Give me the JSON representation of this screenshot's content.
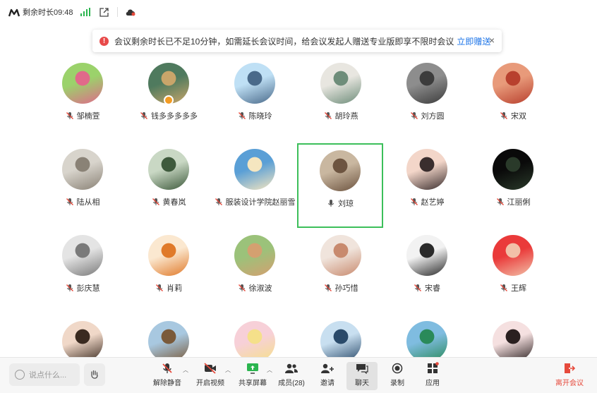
{
  "topbar": {
    "remaining_label": "剩余时长09:48",
    "signal_color": "#2bb54f"
  },
  "notice": {
    "text": "会议剩余时长已不足10分钟，如需延长会议时间，给会议发起人赠送专业版即享不限时会议",
    "link": "立即赠送",
    "close": "×"
  },
  "participants": [
    {
      "name": "邹楠萱",
      "muted": true,
      "c1": "#9bd26b",
      "c2": "#e06a8a"
    },
    {
      "name": "钱多多多多多",
      "muted": true,
      "c1": "#4f7a5e",
      "c2": "#c9a56a",
      "badge": true
    },
    {
      "name": "陈晓玲",
      "muted": true,
      "c1": "#bfe0f5",
      "c2": "#4a6a8a"
    },
    {
      "name": "胡玲燕",
      "muted": true,
      "c1": "#e8e6e0",
      "c2": "#6e8d7a"
    },
    {
      "name": "刘方圆",
      "muted": true,
      "c1": "#8d8d8d",
      "c2": "#3c3c3c"
    },
    {
      "name": "宋双",
      "muted": true,
      "c1": "#e89a7a",
      "c2": "#b8402e"
    },
    {
      "name": "陆从相",
      "muted": true,
      "c1": "#d8d4cc",
      "c2": "#8a8276"
    },
    {
      "name": "黄春岚",
      "muted": true,
      "c1": "#c9d8c4",
      "c2": "#3e5a3c"
    },
    {
      "name": "服装设计学院赵丽雪",
      "muted": true,
      "c1": "#5a9fd6",
      "c2": "#f5e6c0"
    },
    {
      "name": "刘琼",
      "muted": false,
      "speaking": true,
      "c1": "#c9b7a0",
      "c2": "#6d5440"
    },
    {
      "name": "赵艺婷",
      "muted": true,
      "c1": "#f3d6c9",
      "c2": "#3a2e2e"
    },
    {
      "name": "江丽俐",
      "muted": true,
      "c1": "#0a0a0a",
      "c2": "#2a3a2a"
    },
    {
      "name": "彭庆慧",
      "muted": true,
      "c1": "#e4e4e4",
      "c2": "#7a7a7a"
    },
    {
      "name": "肖莉",
      "muted": true,
      "c1": "#fbe8d0",
      "c2": "#e07a2a"
    },
    {
      "name": "徐淑波",
      "muted": true,
      "c1": "#9bc27a",
      "c2": "#d4a070"
    },
    {
      "name": "孙巧惜",
      "muted": true,
      "c1": "#f0e4dc",
      "c2": "#c88a6e"
    },
    {
      "name": "宋睿",
      "muted": true,
      "c1": "#f2f2f2",
      "c2": "#2a2a2a"
    },
    {
      "name": "王辉",
      "muted": true,
      "c1": "#ea3a3a",
      "c2": "#f2c0a8"
    },
    {
      "name": "",
      "muted": true,
      "c1": "#f0d8c8",
      "c2": "#3a2a20"
    },
    {
      "name": "",
      "muted": true,
      "c1": "#a8c8e0",
      "c2": "#7a5a3a"
    },
    {
      "name": "",
      "muted": true,
      "c1": "#f7d0d8",
      "c2": "#f5e08a"
    },
    {
      "name": "",
      "muted": true,
      "c1": "#c8dff0",
      "c2": "#2a4a6a"
    },
    {
      "name": "",
      "muted": true,
      "c1": "#7fbce0",
      "c2": "#2a8a5a"
    },
    {
      "name": "",
      "muted": true,
      "c1": "#f5e0e0",
      "c2": "#2a2020"
    }
  ],
  "toolbar": {
    "chat_placeholder": "说点什么...",
    "unmute": "解除静音",
    "start_video": "开启视频",
    "share_screen": "共享屏幕",
    "members": "成员(28)",
    "invite": "邀请",
    "chat": "聊天",
    "record": "录制",
    "apps": "应用",
    "leave": "离开会议",
    "leave_color": "#e64a3c",
    "share_color": "#2bb54f"
  }
}
